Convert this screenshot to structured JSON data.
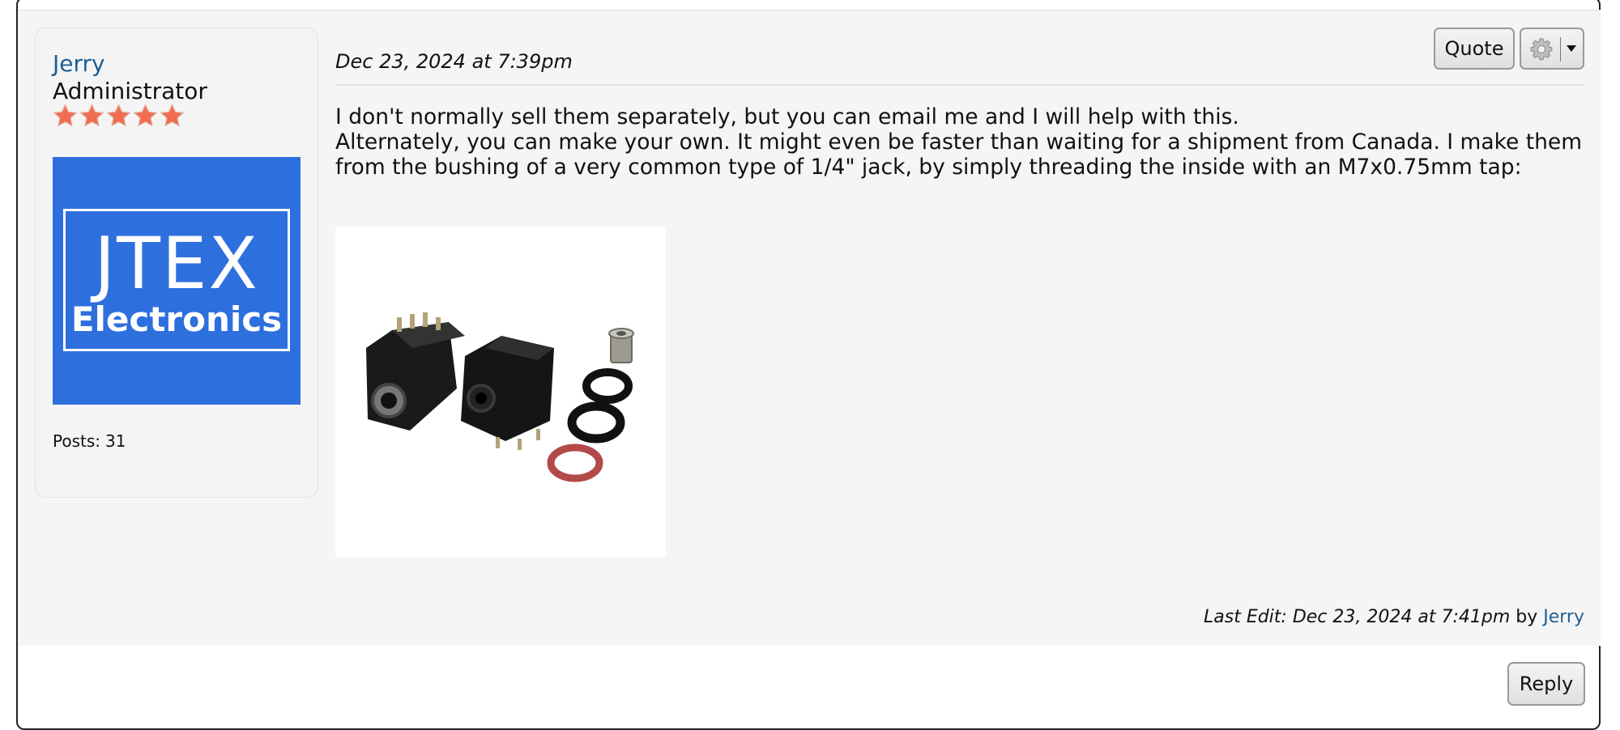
{
  "post": {
    "date": "Dec 23, 2024 at 7:39pm",
    "author": {
      "name": "Jerry",
      "rank": "Administrator",
      "stars": 5,
      "avatar_logo_line1": "JTEX",
      "avatar_logo_line2": "Electronics",
      "posts_label": "Posts:",
      "posts_count": "31"
    },
    "message": {
      "line1": "I don't normally sell them separately, but you can email me and I will help with this.",
      "line2": "Alternately, you can make your own. It might even be faster than waiting for a shipment from Canada. I make them from the bushing of a very common type of 1/4\" jack, by simply threading the inside with an M7x0.75mm tap:"
    },
    "last_edit": {
      "prefix": "Last Edit: Dec 23, 2024 at 7:41pm",
      "by": "by",
      "editor": "Jerry"
    }
  },
  "buttons": {
    "quote": "Quote",
    "reply": "Reply",
    "options_icon": "gear-icon"
  },
  "colors": {
    "link": "#1e5f93",
    "avatar_bg": "#2e6fde",
    "post_bg": "#f5f5f5",
    "star": "#f26c4f"
  }
}
